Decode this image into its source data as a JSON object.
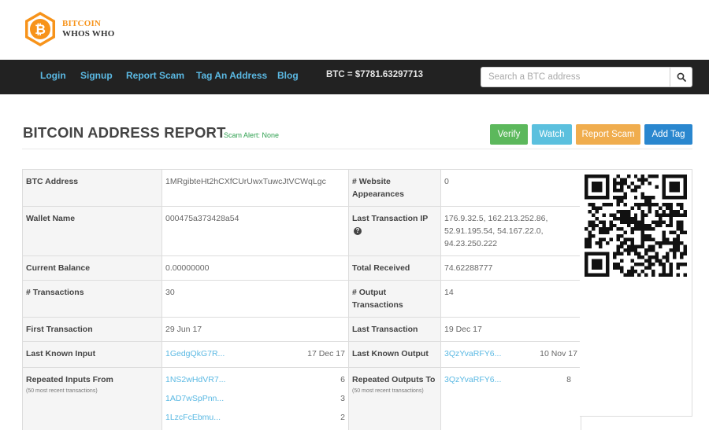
{
  "logo": {
    "line1": "BITCOIN",
    "line2": "WHOS WHO"
  },
  "nav": {
    "links": [
      "Login",
      "Signup",
      "Report Scam",
      "Tag An Address",
      "Blog"
    ],
    "btc_price": "BTC = $7781.63297713",
    "search_placeholder": "Search a BTC address",
    "search_icon": "magnifier-icon"
  },
  "header": {
    "title": "BITCOIN ADDRESS REPORT",
    "scam_alert": "Scam Alert: None",
    "buttons": {
      "verify": "Verify",
      "watch": "Watch",
      "report": "Report Scam",
      "tag": "Add Tag"
    }
  },
  "report": {
    "btc_address_label": "BTC Address",
    "btc_address": "1MRgibteHt2hCXfCUrUwxTuwcJtVCWqLgc",
    "website_appearances_label": "# Website Appearances",
    "website_appearances": "0",
    "wallet_name_label": "Wallet Name",
    "wallet_name": "000475a373428a54",
    "last_ip_label": "Last Transaction IP",
    "last_ip": "176.9.32.5, 162.213.252.86, 52.91.195.54, 54.167.22.0, 94.23.250.222",
    "current_balance_label": "Current Balance",
    "current_balance": "0.00000000",
    "total_received_label": "Total Received",
    "total_received": "74.62288777",
    "transactions_label": "# Transactions",
    "transactions": "30",
    "output_transactions_label": "# Output Transactions",
    "output_transactions": "14",
    "first_tx_label": "First Transaction",
    "first_tx": "29 Jun 17",
    "last_tx_label": "Last Transaction",
    "last_tx": "19 Dec 17",
    "last_input_label": "Last Known Input",
    "last_input_addr": "1GedgQkG7R...",
    "last_input_date": "17 Dec 17",
    "last_output_label": "Last Known Output",
    "last_output_addr": "3QzYvaRFY6...",
    "last_output_date": "10 Nov 17",
    "repeated_inputs_label": "Repeated Inputs From",
    "repeated_inputs_note": "(50 most recent transactions)",
    "repeated_inputs": [
      {
        "addr": "1NS2wHdVR7...",
        "count": "6"
      },
      {
        "addr": "1AD7wSpPnn...",
        "count": "3"
      },
      {
        "addr": "1LzcFcEbmu...",
        "count": "2"
      }
    ],
    "repeated_outputs_label": "Repeated Outputs To",
    "repeated_outputs_note": "(50 most recent transactions)",
    "repeated_outputs": [
      {
        "addr": "3QzYvaRFY6...",
        "count": "8"
      }
    ]
  },
  "colors": {
    "navbar": "#222222",
    "link": "#5bb9e3",
    "verify": "#5cb85c",
    "watch": "#5bc0de",
    "report": "#f0ad4e",
    "tag": "#2a87cf",
    "alert": "#2ea04f",
    "brand": "#f7931a"
  }
}
